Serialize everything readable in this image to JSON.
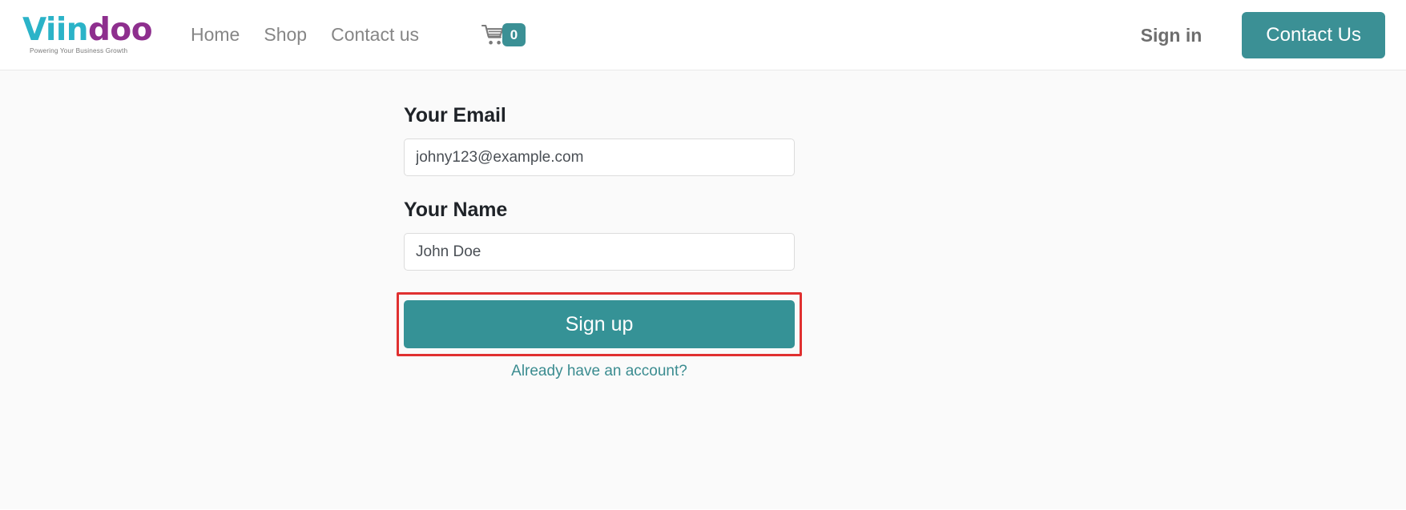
{
  "header": {
    "brand": {
      "name_part1": "Viin",
      "name_part2": "doo",
      "tagline": "Powering Your Business Growth",
      "color_part1": "#2bb3c8",
      "color_part2": "#8e2f8e"
    },
    "nav": [
      {
        "label": "Home"
      },
      {
        "label": "Shop"
      },
      {
        "label": "Contact us"
      }
    ],
    "cart": {
      "icon": "shopping-cart-icon",
      "count": "0",
      "badge_color": "#3b9095"
    },
    "signin_label": "Sign in",
    "contact_button_label": "Contact Us",
    "accent_color": "#3b9095"
  },
  "form": {
    "email": {
      "label": "Your Email",
      "value": "johny123@example.com",
      "placeholder": "johny123@example.com"
    },
    "name": {
      "label": "Your Name",
      "value": "John Doe",
      "placeholder": "John Doe"
    },
    "submit_label": "Sign up",
    "submit_color": "#359296",
    "account_link_label": "Already have an account?",
    "account_link_color": "#3b8c90",
    "highlight_color": "#e03030"
  }
}
